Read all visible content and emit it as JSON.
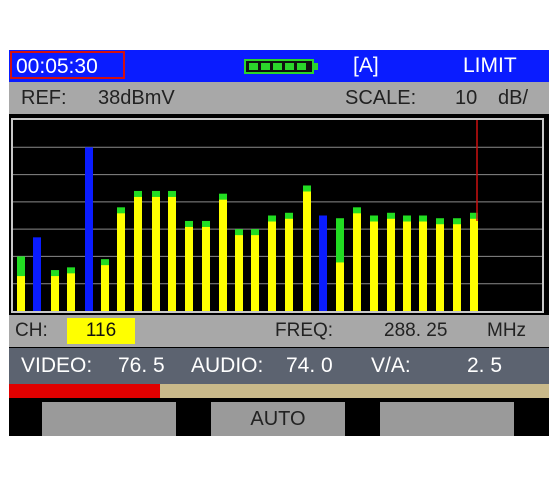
{
  "titlebar": {
    "clock": "00:05:30",
    "mode": "[A]",
    "limit": "LIMIT",
    "battery_level": 1.0,
    "battery_icon": "battery-full-icon"
  },
  "reference": {
    "ref_label": "REF:",
    "ref_value": "38dBmV",
    "scale_label": "SCALE:",
    "scale_value": "10",
    "scale_unit": "dB/"
  },
  "chart_data": {
    "type": "bar",
    "title": "",
    "grid": true,
    "ylim": [
      0,
      7
    ],
    "series": [
      {
        "name": "",
        "values": [
          1.5,
          2.7,
          1.5,
          1.6,
          6.0,
          1.9,
          3.8,
          4.4,
          4.4,
          4.4,
          3.3,
          3.3,
          4.3,
          3.0,
          3.0,
          3.5,
          3.6,
          4.6,
          3.5,
          2.0,
          3.8,
          3.5,
          3.6,
          3.5,
          3.5,
          3.4,
          3.4,
          3.6,
          3.3
        ]
      },
      {
        "name": "",
        "values": [
          2.0,
          2.7,
          1.5,
          1.6,
          6.0,
          1.9,
          3.8,
          4.4,
          4.4,
          4.4,
          3.3,
          3.3,
          4.3,
          3.0,
          3.0,
          3.5,
          3.6,
          4.6,
          3.5,
          3.4,
          3.8,
          3.5,
          3.6,
          3.5,
          3.5,
          3.4,
          3.4,
          3.6,
          3.3
        ]
      }
    ],
    "colors": {
      "bar": "#ffff00",
      "bar_top": "#22dd22",
      "selected": "#0a1cff",
      "grid": "#8a8a8a",
      "marker": "#cc1111"
    }
  },
  "channel_bar": {
    "ch_label": "CH:",
    "ch_value": "116",
    "freq_label": "FREQ:",
    "freq_value": "288. 25",
    "freq_unit": "MHz"
  },
  "readings": {
    "video_label": "VIDEO:",
    "video_value": "76. 5",
    "audio_label": "AUDIO:",
    "audio_value": "74. 0",
    "va_label": "V/A:",
    "va_value": "2. 5"
  },
  "progress": {
    "fraction": 0.28
  },
  "softkeys": [
    {
      "label": ""
    },
    {
      "label": "AUTO"
    },
    {
      "label": ""
    }
  ]
}
